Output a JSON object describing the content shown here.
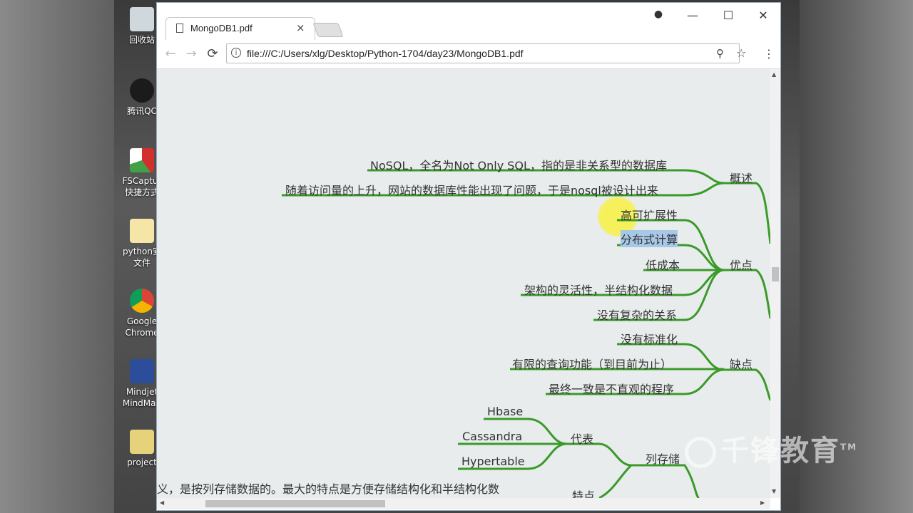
{
  "desktop": {
    "icons": [
      {
        "label": "回收站",
        "color": "#cfd8dc"
      },
      {
        "label": "腾讯QC",
        "color": "#1b1b1b"
      },
      {
        "label": "FSCaptur\n快捷方式",
        "color": "#d32f2f"
      },
      {
        "label": "python安\n文件",
        "color": "#f5e6a8"
      },
      {
        "label": "Google\nChrome",
        "color": "#4285f4"
      },
      {
        "label": "Mindjet\nMindMan",
        "color": "#2c4d9a"
      },
      {
        "label": "project",
        "color": "#e6d27a"
      }
    ]
  },
  "browser": {
    "tab_title": "MongoDB1.pdf",
    "tab_close": "×",
    "url": "file:///C:/Users/xlg/Desktop/Python-1704/day23/MongoDB1.pdf",
    "controls": {
      "minimize": "—",
      "maximize": "☐",
      "close": "✕",
      "account": "●"
    },
    "nav": {
      "back": "←",
      "forward": "→",
      "reload": "⟳",
      "info": "i",
      "zoom": "⚲",
      "star": "☆",
      "menu": "⋮"
    }
  },
  "mindmap": {
    "branches": [
      {
        "name": "概述",
        "children": [
          "NoSQL，全名为Not Only SQL，指的是非关系型的数据库",
          "随着访问量的上升，网站的数据库性能出现了问题，于是nosql被设计出来"
        ]
      },
      {
        "name": "优点",
        "children": [
          "高可扩展性",
          "分布式计算",
          "低成本",
          "架构的灵活性，半结构化数据",
          "没有复杂的关系"
        ]
      },
      {
        "name": "缺点",
        "children": [
          "没有标准化",
          "有限的查询功能（到目前为止）",
          "最终一致是不直观的程序"
        ]
      },
      {
        "name": "列存储",
        "children": [
          {
            "name": "代表",
            "children": [
              "Hbase",
              "Cassandra",
              "Hypertable"
            ]
          },
          {
            "name": "特点",
            "children": []
          }
        ]
      }
    ],
    "partial_text": "义，是按列存储数据的。最大的特点是方便存储结构化和半结构化数",
    "highlighted": "分布式计算"
  },
  "watermark": {
    "text": "千锋教育",
    "tm": "TM"
  },
  "colors": {
    "branch": "#3a9a2a",
    "text": "#333333",
    "highlight": "#a8c8e8",
    "page_bg": "#e9ecec"
  }
}
